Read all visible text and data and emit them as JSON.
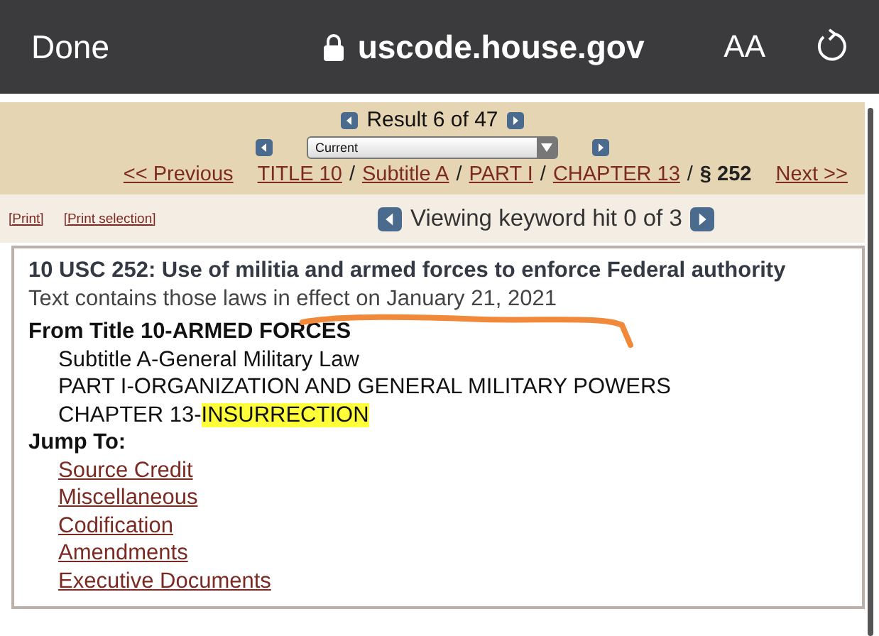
{
  "browser_bar": {
    "done": "Done",
    "url": "uscode.house.gov",
    "text_size": "AA"
  },
  "result_nav": {
    "label": "Result 6 of 47",
    "dropdown": "Current"
  },
  "breadcrumb": {
    "previous": "<< Previous",
    "separator": "/",
    "crumbs": [
      {
        "text": "TITLE 10",
        "link": true
      },
      {
        "text": "Subtitle A",
        "link": true
      },
      {
        "text": "PART I",
        "link": true
      },
      {
        "text": "CHAPTER 13",
        "link": true
      },
      {
        "text": "§ 252",
        "link": false
      }
    ],
    "next": "Next >>"
  },
  "print_links": [
    "[Print]",
    "[Print selection]"
  ],
  "keyword_nav": "Viewing keyword hit 0 of 3",
  "document": {
    "title": "10 USC 252: Use of militia and armed forces to enforce Federal authority",
    "note": "Text contains those laws in effect on January 21, 2021",
    "from": "From Title 10-ARMED FORCES",
    "hierarchy": [
      {
        "text": "Subtitle A-General Military Law"
      },
      {
        "text": "PART I-ORGANIZATION AND GENERAL MILITARY POWERS"
      },
      {
        "text": "CHAPTER 13-",
        "highlight": "INSURRECTION"
      }
    ],
    "jump_label": "Jump To:",
    "jump_links": [
      "Source Credit",
      "Miscellaneous",
      "Codification",
      "Amendments",
      "Executive Documents"
    ]
  }
}
